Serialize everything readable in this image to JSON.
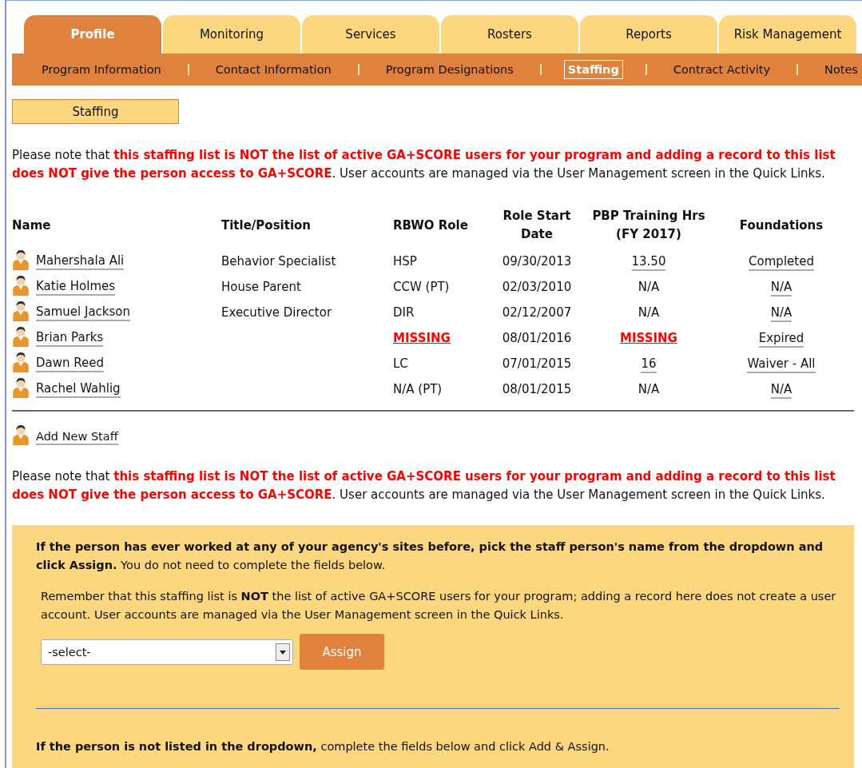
{
  "tabs": [
    {
      "label": "Profile",
      "selected": true
    },
    {
      "label": "Monitoring",
      "selected": false
    },
    {
      "label": "Services",
      "selected": false
    },
    {
      "label": "Rosters",
      "selected": false
    },
    {
      "label": "Reports",
      "selected": false
    },
    {
      "label": "Risk Management",
      "selected": false
    }
  ],
  "subnav": [
    {
      "label": "Program Information",
      "selected": false
    },
    {
      "label": "Contact Information",
      "selected": false
    },
    {
      "label": "Program Designations",
      "selected": false
    },
    {
      "label": "Staffing",
      "selected": true
    },
    {
      "label": "Contract Activity",
      "selected": false
    },
    {
      "label": "Notes",
      "selected": false
    }
  ],
  "section_button": "Staffing",
  "notice_top": "Please note that **this staffing list is NOT the list of active GA+SCORE users for your program and adding a record to this list does NOT give the person access to GA+SCORE**. User accounts are managed via the User Management screen in the Quick Links.",
  "table": {
    "columns": [
      "Name",
      "Title/Position",
      "RBWO Role",
      "Role Start Date",
      "PBP Training Hrs (FY 2017)",
      "Foundations"
    ],
    "rows": [
      {
        "name": "Mahershala Ali",
        "title": "Behavior Specialist",
        "role": {
          "text": "HSP",
          "kind": "plain"
        },
        "start_date": "09/30/2013",
        "training_hrs": {
          "text": "13.50",
          "kind": "link"
        },
        "foundations": {
          "text": "Completed",
          "kind": "link"
        }
      },
      {
        "name": "Katie Holmes",
        "title": "House Parent",
        "role": {
          "text": "CCW (PT)",
          "kind": "plain"
        },
        "start_date": "02/03/2010",
        "training_hrs": {
          "text": "N/A",
          "kind": "plain"
        },
        "foundations": {
          "text": "N/A",
          "kind": "link"
        }
      },
      {
        "name": "Samuel Jackson",
        "title": "Executive Director",
        "role": {
          "text": "DIR",
          "kind": "plain"
        },
        "start_date": "02/12/2007",
        "training_hrs": {
          "text": "N/A",
          "kind": "plain"
        },
        "foundations": {
          "text": "N/A",
          "kind": "link"
        }
      },
      {
        "name": "Brian Parks",
        "title": "",
        "role": {
          "text": "MISSING",
          "kind": "missing"
        },
        "start_date": "08/01/2016",
        "training_hrs": {
          "text": "MISSING",
          "kind": "missing"
        },
        "foundations": {
          "text": "Expired",
          "kind": "link"
        }
      },
      {
        "name": "Dawn Reed",
        "title": "",
        "role": {
          "text": "LC",
          "kind": "plain"
        },
        "start_date": "07/01/2015",
        "training_hrs": {
          "text": "16",
          "kind": "link"
        },
        "foundations": {
          "text": "Waiver - All",
          "kind": "link"
        }
      },
      {
        "name": "Rachel Wahlig",
        "title": "",
        "role": {
          "text": "N/A (PT)",
          "kind": "plain"
        },
        "start_date": "08/01/2015",
        "training_hrs": {
          "text": "N/A",
          "kind": "plain"
        },
        "foundations": {
          "text": "N/A",
          "kind": "link"
        }
      }
    ]
  },
  "add_staff": "Add New Staff",
  "notice_bottom": "Please note that **this staffing list is NOT the list of active GA+SCORE users for your program and adding a record to this list does NOT give the person access to GA+SCORE**. User accounts are managed via the User Management screen in the Quick Links.",
  "assign_panel": {
    "intro": "**If the person has ever worked at any of your agency's sites before, pick the staff person's name from the dropdown and click Assign.** You do not need to complete the fields below.",
    "reminder": "Remember that this staffing list is **NOT** the list of active GA+SCORE users for your program; adding a record here does not create a user account. User accounts are managed via the User Management screen in the Quick Links.",
    "select": {
      "value": "-select-"
    },
    "button": "Assign",
    "not_listed": "**If the person is not listed in the dropdown,** complete the fields below and click Add & Assign."
  }
}
